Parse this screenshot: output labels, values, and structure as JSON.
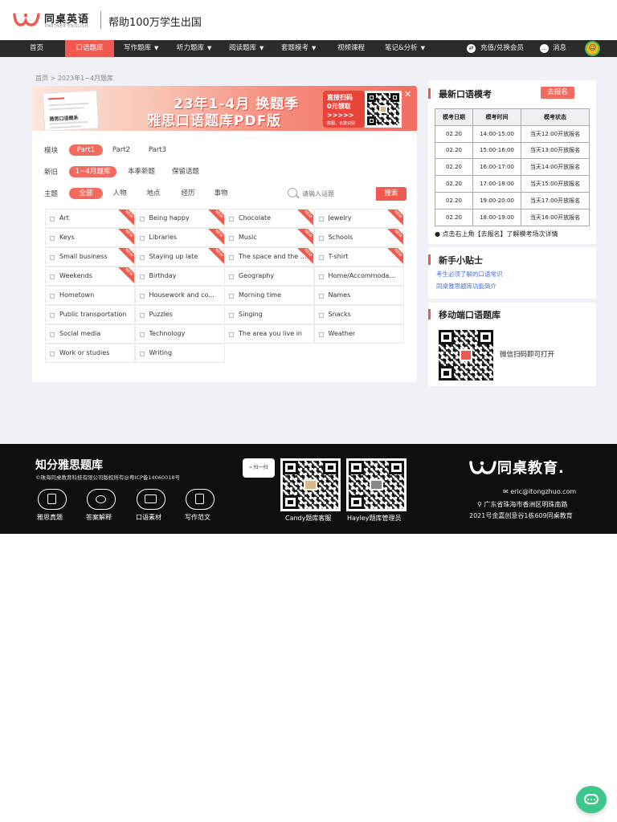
{
  "header": {
    "brand_cn": "同桌英语",
    "brand_en": "PARTNER ENGLISH",
    "slogan": "帮助100万学生出国"
  },
  "nav": {
    "items": [
      {
        "label": "首页",
        "dropdown": false
      },
      {
        "label": "口语题库",
        "dropdown": false,
        "active": true
      },
      {
        "label": "写作题库",
        "dropdown": true
      },
      {
        "label": "听力题库",
        "dropdown": true
      },
      {
        "label": "阅读题库",
        "dropdown": true
      },
      {
        "label": "套题模考",
        "dropdown": true
      },
      {
        "label": "视频课程",
        "dropdown": false
      },
      {
        "label": "笔记&分析",
        "dropdown": true
      }
    ],
    "recharge": "充值/兑换会员",
    "messages": "消息"
  },
  "breadcrumb": "首页 > 2023年1~4月题库",
  "banner": {
    "line1": "23年1-4月 换题季",
    "line2": "雅思口语题库PDF版",
    "tag": "直接扫码",
    "tag2": "0元领取",
    "tag3": ">>>>>",
    "tag_small": "截图、长按识别",
    "doc_title": "雅思口语题系",
    "close": "✕"
  },
  "filters": {
    "module_label": "模块",
    "module_options": [
      "Part1",
      "Part2",
      "Part3"
    ],
    "newold_label": "新旧",
    "newold_options": [
      "1~4月题库",
      "本季新题",
      "保留话题"
    ],
    "theme_label": "主题",
    "theme_options": [
      "全部",
      "人物",
      "地点",
      "经历",
      "事物"
    ],
    "search_placeholder": "请输入话题",
    "search_button": "搜索"
  },
  "topics": [
    {
      "name": "Art",
      "new": true
    },
    {
      "name": "Being happy",
      "new": true
    },
    {
      "name": "Chocolate",
      "new": true
    },
    {
      "name": "Jewelry",
      "new": true
    },
    {
      "name": "Keys",
      "new": true
    },
    {
      "name": "Libraries",
      "new": true
    },
    {
      "name": "Music",
      "new": true
    },
    {
      "name": "Schools",
      "new": true
    },
    {
      "name": "Small business",
      "new": true
    },
    {
      "name": "Staying up late",
      "new": true
    },
    {
      "name": "The space and the ...",
      "new": true
    },
    {
      "name": "T-shirt",
      "new": true
    },
    {
      "name": "Weekends",
      "new": true
    },
    {
      "name": "Birthday",
      "new": false
    },
    {
      "name": "Geography",
      "new": false
    },
    {
      "name": "Home/Accommoda...",
      "new": false
    },
    {
      "name": "Hometown",
      "new": false
    },
    {
      "name": "Housework and co...",
      "new": false
    },
    {
      "name": "Morning time",
      "new": false
    },
    {
      "name": "Names",
      "new": false
    },
    {
      "name": "Public transportation",
      "new": false
    },
    {
      "name": "Puzzles",
      "new": false
    },
    {
      "name": "Singing",
      "new": false
    },
    {
      "name": "Snacks",
      "new": false
    },
    {
      "name": "Social media",
      "new": false
    },
    {
      "name": "Technology",
      "new": false
    },
    {
      "name": "The area you live in",
      "new": false
    },
    {
      "name": "Weather",
      "new": false
    },
    {
      "name": "Work or studies",
      "new": false
    },
    {
      "name": "Writing",
      "new": false
    }
  ],
  "new_badge": "NEW",
  "mock": {
    "title": "最新口语模考",
    "signup": "去报名",
    "headers": [
      "模考日期",
      "模考时间",
      "模考状态"
    ],
    "rows": [
      [
        "02.20",
        "14:00-15:00",
        "当天12:00开放报名"
      ],
      [
        "02.20",
        "15:00-16:00",
        "当天13:00开放报名"
      ],
      [
        "02.20",
        "16:00-17:00",
        "当天14:00开放报名"
      ],
      [
        "02.20",
        "17:00-18:00",
        "当天15:00开放报名"
      ],
      [
        "02.20",
        "19:00-20:00",
        "当天17:00开放报名"
      ],
      [
        "02.20",
        "18:00-19:00",
        "当天16:00开放报名"
      ]
    ],
    "note": "● 点击右上角【去报名】了解模考场次详情"
  },
  "tips": {
    "title": "新手小贴士",
    "links": [
      "考生必须了解的口语常识",
      "同桌雅思题库功能简介"
    ]
  },
  "mobile": {
    "title": "移动端口语题库",
    "text": "微信扫码即可打开"
  },
  "footer": {
    "title": "知分雅思题库",
    "copyright": "©珠海同桌教育科技有限公司版权所有@粤ICP备14060018号",
    "icons": [
      "雅思真题",
      "答案解释",
      "口语素材",
      "写作范文"
    ],
    "scan": "扫一扫",
    "qr_labels": [
      "Candy题库客服",
      "Hayley题库管理员"
    ],
    "logo": "同桌教育.",
    "email": "eric@itongzhuo.com",
    "addr1": "广东省珠海市香洲区明珠南路",
    "addr2": "2021号金嘉创意谷1栋609同桌教育"
  },
  "colors": {
    "accent": "#f05a4e",
    "nav_bg": "#2b2b2b",
    "page_bg": "#f0f1f6",
    "footer_bg": "#0f0f0f",
    "chat": "#3ec68c"
  }
}
